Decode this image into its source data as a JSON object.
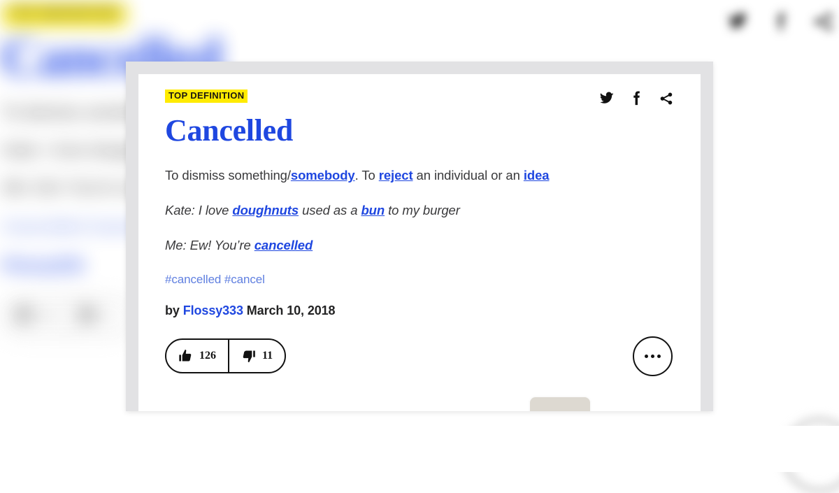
{
  "card": {
    "badge_label": "TOP DEFINITION",
    "word": "Cancelled",
    "social": [
      {
        "name": "twitter-icon",
        "label": "Twitter"
      },
      {
        "name": "facebook-icon",
        "label": "Facebook"
      },
      {
        "name": "share-icon",
        "label": "Share"
      }
    ],
    "definition": {
      "part1": "To dismiss something/",
      "link1": "somebody",
      "part2": ". To ",
      "link2": "reject",
      "part3": " an individual or an ",
      "link3": "idea"
    },
    "example_line_1": {
      "part1": "Kate: I love ",
      "link1": "doughnuts",
      "part2": " used as a ",
      "link2": "bun",
      "part3": " to my burger"
    },
    "example_line_2": {
      "part1": "Me: Ew! You’re ",
      "link1": "cancelled"
    },
    "tags": [
      "#cancelled",
      "#cancel"
    ],
    "byline": {
      "by_label": "by ",
      "author": "Flossy333",
      "date": " March 10, 2018"
    },
    "votes": {
      "up_count": "126",
      "down_count": "11"
    },
    "more_label": "More options"
  },
  "background": {
    "badge_label": "TOP DEFINITION",
    "word": "Cancelled",
    "definition_line": "To dismiss something/somebody. To reject an individual or an idea",
    "example_line_1": "Kate: I love doughnuts used as a bun to my burger",
    "example_line_2": "Me: Ew! You’re cancelled",
    "tags": "#cancelled #cancel",
    "by_prefix": "by ",
    "author": "Flossy333",
    "vote_up": "126",
    "vote_down": "11"
  },
  "colors": {
    "link_blue": "#1f47e0",
    "badge_yellow": "#ffeb00",
    "tag_blue": "#5f7fe0",
    "body_text": "#3a3a3c",
    "card_frame": "#e2e2e4"
  }
}
